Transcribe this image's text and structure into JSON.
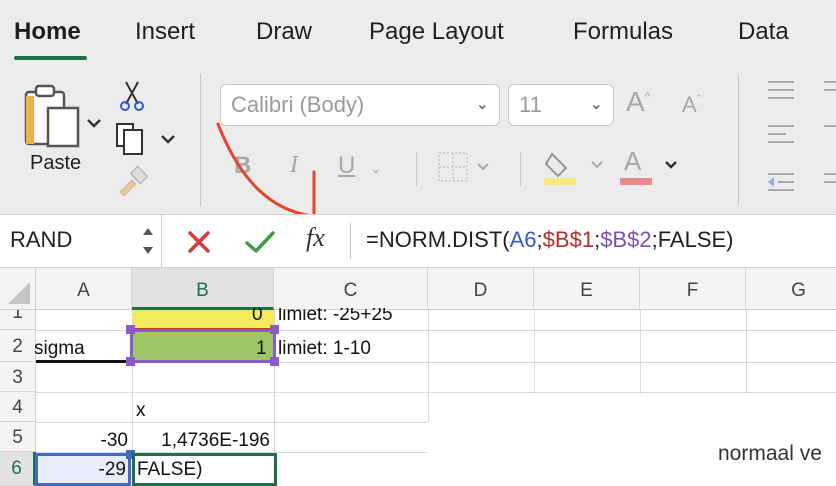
{
  "tabs": [
    {
      "label": "Home",
      "active": true
    },
    {
      "label": "Insert",
      "active": false
    },
    {
      "label": "Draw",
      "active": false
    },
    {
      "label": "Page Layout",
      "active": false
    },
    {
      "label": "Formulas",
      "active": false
    },
    {
      "label": "Data",
      "active": false
    }
  ],
  "ribbon": {
    "paste_label": "Paste",
    "font_name": "Calibri (Body)",
    "font_size": "11",
    "bold": "B",
    "italic": "I",
    "underline": "U",
    "font_color_letter": "A",
    "grow_font": "A",
    "shrink_font": "A",
    "highlight_color": "#f3ea7e",
    "font_color": "#e98b8b"
  },
  "formula_bar": {
    "name_box": "RAND",
    "fx": "fx",
    "formula_parts": [
      {
        "text": "=NORM.DIST(",
        "color": "#1f1f1f"
      },
      {
        "text": "A6",
        "color": "#2f5cc4"
      },
      {
        "text": ";",
        "color": "#1f1f1f"
      },
      {
        "text": "$B$1",
        "color": "#b22d2d"
      },
      {
        "text": ";",
        "color": "#1f1f1f"
      },
      {
        "text": "$B$2",
        "color": "#7a4fb5"
      },
      {
        "text": ";FALSE)",
        "color": "#1f1f1f"
      }
    ]
  },
  "columns": [
    "A",
    "B",
    "C",
    "D",
    "E",
    "F",
    "G"
  ],
  "rows": [
    "1",
    "2",
    "3",
    "4",
    "5",
    "6"
  ],
  "cells": {
    "a2": "sigma",
    "b1": "0",
    "c1": "limiet: -25+25",
    "b2": "1",
    "c2": "limiet: 1-10",
    "b4": "x",
    "a5": "-30",
    "b5": "1,4736E-196",
    "a6": "-29",
    "b6": "FALSE)",
    "chart_text": "normaal ve"
  },
  "colors": {
    "accent": "#1e7145",
    "b1_fill": "#f2ea5a",
    "b2_fill": "#9fc569",
    "ref_a6": "#3f6ac8",
    "ref_b1": "#c0392b",
    "ref_b2": "#8a5cc7",
    "annotation": "#e8432e"
  }
}
